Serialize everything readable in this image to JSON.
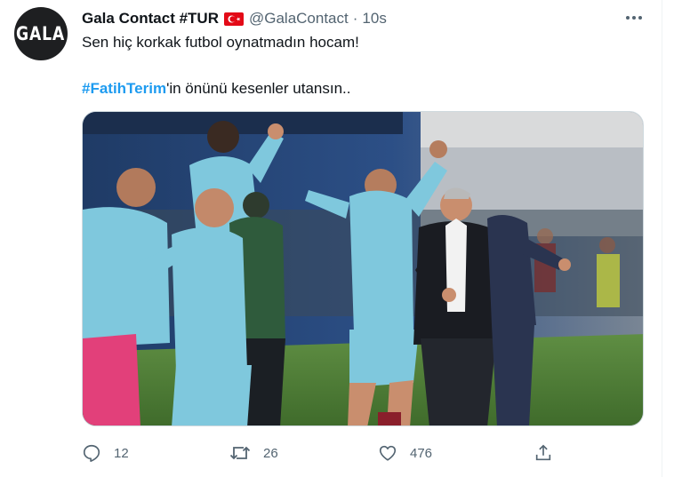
{
  "tweet": {
    "avatar_text": "GALA",
    "display_name": "Gala Contact #TUR",
    "flag_icon": "turkey-flag-icon",
    "handle": "@GalaContact",
    "separator": "·",
    "time": "10s",
    "text_line1": "Sen hiç korkak futbol oynatmadın hocam!",
    "hashtag": "#FatihTerim",
    "text_line2_rest": "'in önünü kesenler utansın..",
    "media_icon": "photo-celebrating-team-bench",
    "actions": {
      "reply_count": "12",
      "retweet_count": "26",
      "like_count": "476"
    },
    "colors": {
      "link": "#1d9bf0",
      "secondary_text": "#536471",
      "flag_red": "#e30a17"
    }
  }
}
